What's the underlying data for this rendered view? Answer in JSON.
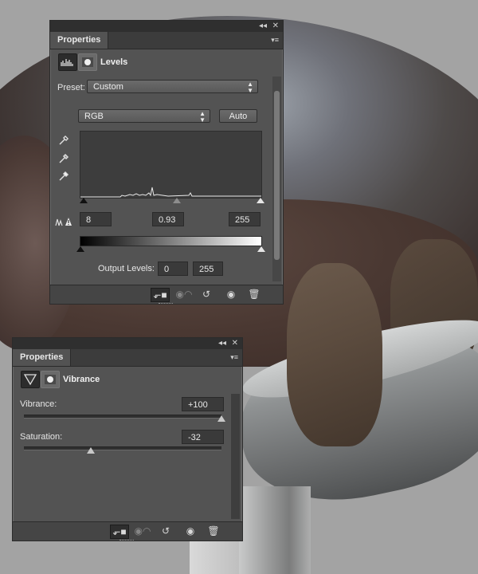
{
  "levels_panel": {
    "tab_label": "Properties",
    "title": "Levels",
    "preset_label": "Preset:",
    "preset_value": "Custom",
    "channel_value": "RGB",
    "auto_label": "Auto",
    "input_black": "8",
    "input_gamma": "0.93",
    "input_white": "255",
    "output_label": "Output Levels:",
    "output_black": "0",
    "output_white": "255"
  },
  "vibrance_panel": {
    "tab_label": "Properties",
    "title": "Vibrance",
    "vibrance_label": "Vibrance:",
    "vibrance_value": "+100",
    "vibrance_level": 100,
    "saturation_label": "Saturation:",
    "saturation_value": "-32",
    "saturation_level": -32
  },
  "footer_icons": [
    "clip-to-layer-icon",
    "view-previous-icon",
    "reset-icon",
    "visibility-eye-icon",
    "trash-icon"
  ]
}
